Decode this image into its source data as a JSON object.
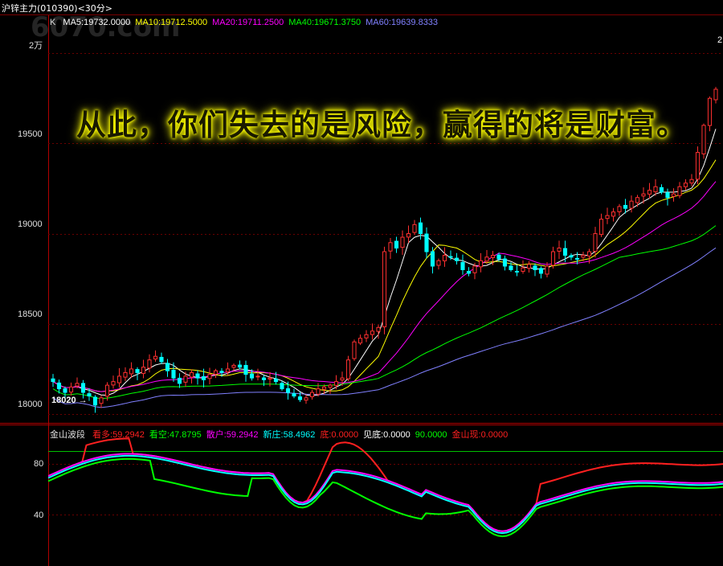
{
  "title": {
    "symbol": "沪锌主力",
    "code": "(010390)",
    "period": "<30分>"
  },
  "watermark": "6070.com",
  "main": {
    "type_label": "K",
    "ma": [
      {
        "name": "MA5",
        "value": "19732.0000",
        "color": "#ffffff"
      },
      {
        "name": "MA10",
        "value": "19712.5000",
        "color": "#ffff00"
      },
      {
        "name": "MA20",
        "value": "19711.2500",
        "color": "#ff00ff"
      },
      {
        "name": "MA40",
        "value": "19671.3750",
        "color": "#00ff00"
      },
      {
        "name": "MA60",
        "value": "19639.8333",
        "color": "#8080ff"
      }
    ],
    "y_ticks": [
      "2万",
      "19500",
      "19000",
      "18500",
      "18000"
    ],
    "low_label": "18020",
    "corner_mark": "2"
  },
  "banner": "从此，你们失去的是风险，赢得的将是财富。",
  "indicator": {
    "name": "金山波段",
    "values": [
      {
        "name": "看多",
        "value": "59.2942",
        "color": "#ff2020"
      },
      {
        "name": "看空",
        "value": "47.8795",
        "color": "#00ff00"
      },
      {
        "name": "散户",
        "value": "59.2942",
        "color": "#ff00ff"
      },
      {
        "name": "新庄",
        "value": "58.4962",
        "color": "#00ffff"
      },
      {
        "name": "底",
        "value": "0.0000",
        "color": "#ff2020"
      },
      {
        "name": "见底",
        "value": "0.0000",
        "color": "#ffffff"
      },
      {
        "name": "",
        "value": "90.0000",
        "color": "#00ff00"
      },
      {
        "name": "金山现",
        "value": "0.0000",
        "color": "#ff2020"
      }
    ],
    "y_ticks": [
      "80",
      "40"
    ]
  },
  "chart_data": [
    {
      "type": "candlestick",
      "title": "沪锌主力 (010390) <30分>",
      "ylim": [
        17960,
        20210
      ],
      "y_ticks": [
        20000,
        19500,
        19000,
        18500,
        18000
      ],
      "series": [
        {
          "name": "MA5",
          "color": "#ffffff"
        },
        {
          "name": "MA10",
          "color": "#ffff00"
        },
        {
          "name": "MA20",
          "color": "#ff00ff"
        },
        {
          "name": "MA40",
          "color": "#00ff00"
        },
        {
          "name": "MA60",
          "color": "#8080ff"
        }
      ],
      "close_approx": [
        18180,
        18140,
        18120,
        18150,
        18170,
        18120,
        18100,
        18050,
        18090,
        18160,
        18180,
        18210,
        18230,
        18250,
        18230,
        18260,
        18300,
        18320,
        18290,
        18240,
        18200,
        18170,
        18210,
        18230,
        18200,
        18190,
        18220,
        18240,
        18230,
        18250,
        18270,
        18260,
        18220,
        18200,
        18210,
        18190,
        18200,
        18180,
        18140,
        18120,
        18100,
        18080,
        18090,
        18120,
        18140,
        18150,
        18160,
        18180,
        18200,
        18300,
        18400,
        18420,
        18440,
        18460,
        18480,
        18900,
        18950,
        18920,
        18980,
        19000,
        19050,
        19000,
        18900,
        18820,
        18850,
        18880,
        18870,
        18850,
        18800,
        18780,
        18820,
        18850,
        18870,
        18880,
        18860,
        18820,
        18800,
        18790,
        18810,
        18830,
        18800,
        18780,
        18820,
        18900,
        18920,
        18880,
        18870,
        18860,
        18880,
        18900,
        19000,
        19080,
        19100,
        19120,
        19150,
        19140,
        19180,
        19200,
        19220,
        19240,
        19260,
        19230,
        19200,
        19220,
        19260,
        19280,
        19300,
        19450,
        19600,
        19750,
        19800
      ],
      "low_label": 18020
    },
    {
      "type": "line",
      "title": "金山波段",
      "ylim": [
        0,
        110
      ],
      "y_ticks": [
        80,
        40
      ],
      "reference_line": 90,
      "series": [
        {
          "name": "看多",
          "color": "#ff2020"
        },
        {
          "name": "看空",
          "color": "#00ff00"
        },
        {
          "name": "散户",
          "color": "#ff00ff"
        },
        {
          "name": "新庄",
          "color": "#00ffff"
        }
      ]
    }
  ]
}
